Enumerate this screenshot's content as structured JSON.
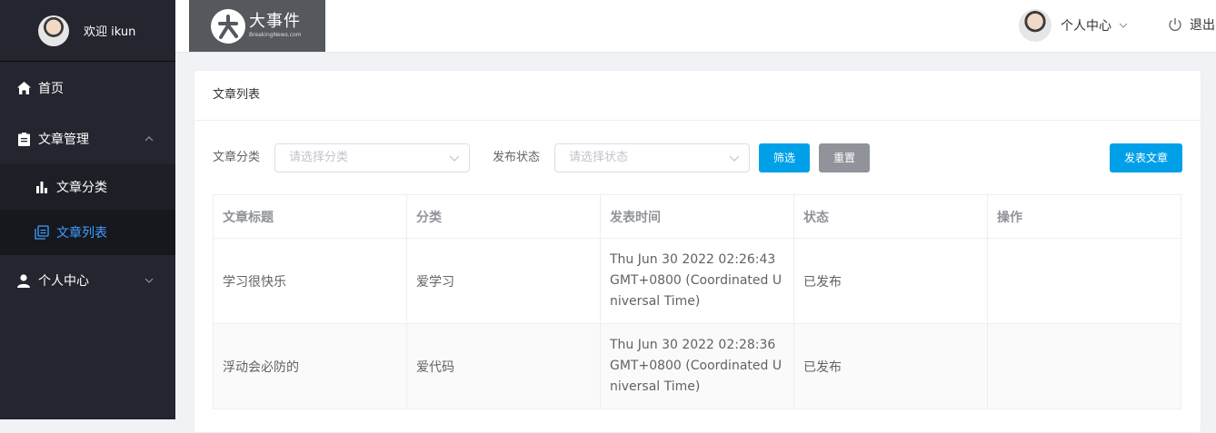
{
  "sidebar": {
    "welcome": "欢迎 ikun",
    "items": [
      {
        "label": "首页",
        "icon": "home-icon"
      },
      {
        "label": "文章管理",
        "icon": "document-icon",
        "expanded": true,
        "children": [
          {
            "label": "文章分类",
            "icon": "bar-chart-icon"
          },
          {
            "label": "文章列表",
            "icon": "copy-document-icon",
            "active": true
          }
        ]
      },
      {
        "label": "个人中心",
        "icon": "user-icon",
        "expanded": false
      }
    ],
    "colors": {
      "bg": "#23262e",
      "active": "#409eff"
    }
  },
  "header": {
    "logo": {
      "title": "大事件",
      "subtitle": "BreakingNews.com"
    },
    "user_menu": "个人中心",
    "logout": "退出"
  },
  "main": {
    "card_title": "文章列表",
    "filters": {
      "category_label": "文章分类",
      "category_placeholder": "请选择分类",
      "status_label": "发布状态",
      "status_placeholder": "请选择状态",
      "filter_button": "筛选",
      "reset_button": "重置",
      "publish_button": "发表文章"
    },
    "table": {
      "columns": [
        "文章标题",
        "分类",
        "发表时间",
        "状态",
        "操作"
      ],
      "rows": [
        {
          "title": "学习很快乐",
          "category": "爱学习",
          "time": "Thu Jun 30 2022 02:26:43 GMT+0800 (Coordinated Universal Time)",
          "status": "已发布",
          "action": ""
        },
        {
          "title": "浮动会必防的",
          "category": "爱代码",
          "time": "Thu Jun 30 2022 02:28:36 GMT+0800 (Coordinated Universal Time)",
          "status": "已发布",
          "action": ""
        }
      ]
    },
    "colors": {
      "primary": "#00a0e9",
      "info": "#909399"
    }
  }
}
